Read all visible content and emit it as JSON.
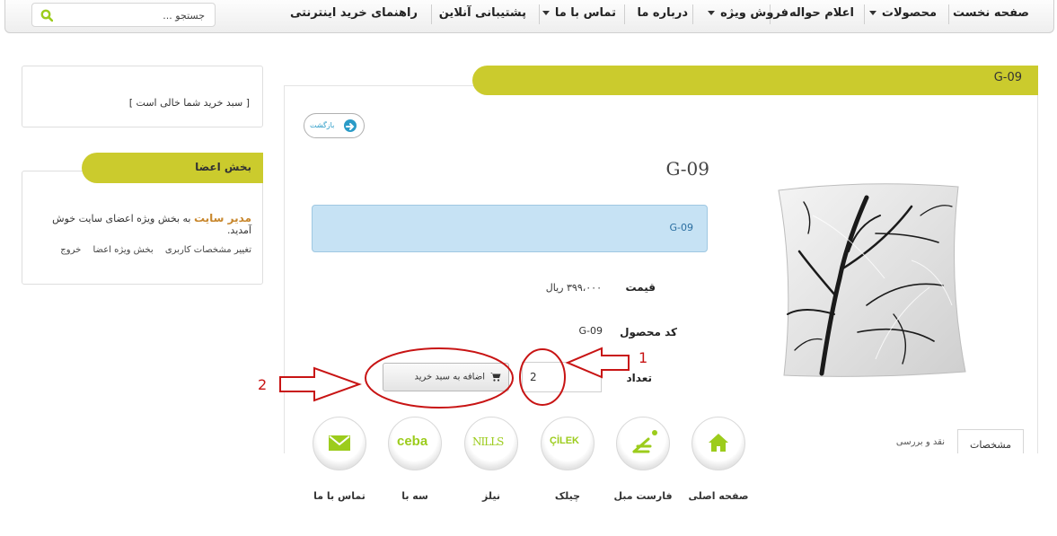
{
  "nav": {
    "items": [
      {
        "label": "صفحه نخست",
        "dropdown": false
      },
      {
        "label": "محصولات",
        "dropdown": true
      },
      {
        "label": "اعلام حواله",
        "dropdown": false
      },
      {
        "label": "فروش ویژه",
        "dropdown": true
      },
      {
        "label": "درباره ما",
        "dropdown": false
      },
      {
        "label": "تماس با ما",
        "dropdown": true
      },
      {
        "label": "پشتیبانی آنلاین",
        "dropdown": false
      },
      {
        "label": "راهنمای خرید اینترنتی",
        "dropdown": false
      }
    ],
    "search_placeholder": "جستجو ..."
  },
  "product": {
    "ribbon_title": "G-09",
    "back_label": "بازگشت",
    "name": "G-09",
    "description": "G-09",
    "price_label": "قیمت",
    "price_value": "۳۹۹،۰۰۰ ریال",
    "code_label": "کد محصول",
    "code_value": "G-09",
    "qty_label": "تعداد",
    "qty_value": "2",
    "add_to_cart_label": "اضافه به سبد خرید"
  },
  "tabs": {
    "specs": "مشخصات",
    "review": "نقد و بررسی"
  },
  "bottom_bar": [
    {
      "label": "صفحه اصلی",
      "icon": "home-icon"
    },
    {
      "label": "فارست مبل",
      "icon": "forest-logo-icon"
    },
    {
      "label": "چیلک",
      "icon": "cilek-logo-icon",
      "logo_text": "ÇİLEK"
    },
    {
      "label": "نیلز",
      "icon": "nills-logo-icon",
      "logo_text": "NILLS"
    },
    {
      "label": "سه با",
      "icon": "ceba-logo-icon",
      "logo_text": "ceba"
    },
    {
      "label": "تماس با ما",
      "icon": "mail-icon"
    }
  ],
  "sidebar": {
    "cart_empty": "[ سبد خرید شما خالی است ]",
    "members_title": "بخش اعضا",
    "admin_name": "مدیر سایت",
    "welcome_text": "به بخش ویژه اعضای سایت خوش آمدید.",
    "links": [
      "تغییر مشخصات کاربری",
      "بخش ویژه اعضا",
      "خروج"
    ]
  },
  "annotations": {
    "label_1": "1",
    "label_2": "2"
  },
  "colors": {
    "accent": "#cbcb2d",
    "link_blue": "#2a9bc7",
    "desc_bg": "#c6e2f4",
    "annotation_red": "#c81414",
    "icon_green": "#9ccc1c"
  }
}
